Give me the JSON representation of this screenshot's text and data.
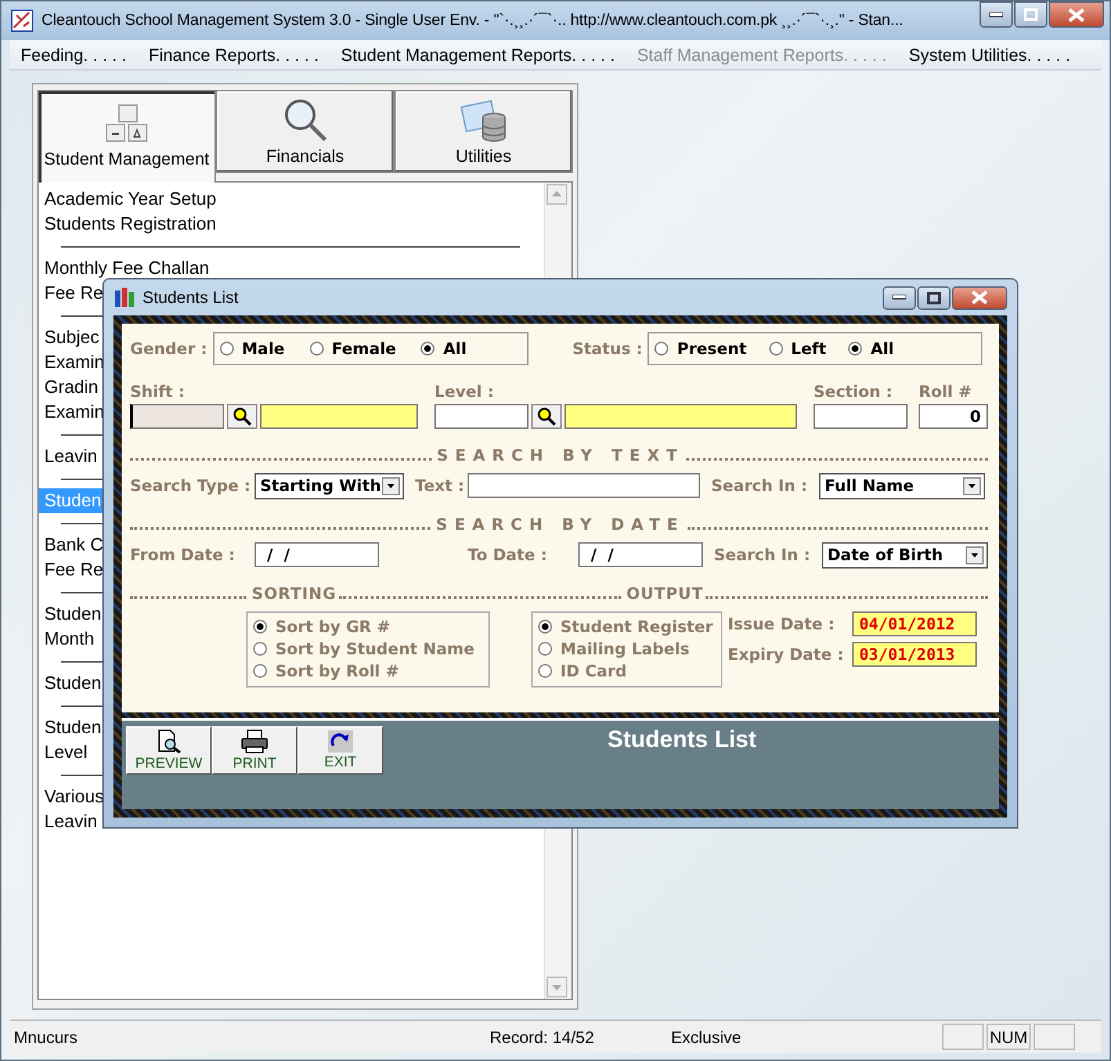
{
  "window": {
    "title": "Cleantouch School Management System 3.0 - Single User Env.     -  \"`·.¸¸.·´¯`·.. http://www.cleantouch.com.pk ¸¸.·´¯`·.¸.\" - Stan..."
  },
  "menu": [
    {
      "label": "Feeding. . . . .",
      "disabled": false
    },
    {
      "label": "Finance Reports. . . . .",
      "disabled": false
    },
    {
      "label": "Student Management Reports. . . . .",
      "disabled": false
    },
    {
      "label": "Staff Management Reports. . . . .",
      "disabled": true
    },
    {
      "label": "System Utilities. . . . .",
      "disabled": false
    }
  ],
  "module_tabs": [
    {
      "label": "Student Management",
      "kind": "keys",
      "selected": true
    },
    {
      "label": "Financials",
      "kind": "magnifier",
      "selected": false
    },
    {
      "label": "Utilities",
      "kind": "database",
      "selected": false
    }
  ],
  "menu_list": [
    [
      {
        "label": "Academic Year Setup",
        "selected": false
      },
      {
        "label": "Students Registration",
        "selected": false
      }
    ],
    [
      {
        "label": "Monthly Fee Challan",
        "selected": false
      },
      {
        "label": "Fee Re",
        "selected": false
      }
    ],
    [
      {
        "label": "Subjec",
        "selected": false
      },
      {
        "label": "Examin",
        "selected": false
      },
      {
        "label": "Gradin",
        "selected": false
      },
      {
        "label": "Examin",
        "selected": false
      }
    ],
    [
      {
        "label": "Leavin",
        "selected": false
      }
    ],
    [
      {
        "label": "Studen",
        "selected": true
      }
    ],
    [
      {
        "label": "Bank C",
        "selected": false
      },
      {
        "label": "Fee Re",
        "selected": false
      }
    ],
    [
      {
        "label": "Studen",
        "selected": false
      },
      {
        "label": "Month",
        "selected": false
      }
    ],
    [
      {
        "label": "Studen",
        "selected": false
      }
    ],
    [
      {
        "label": "Studen",
        "selected": false
      },
      {
        "label": "Level",
        "selected": false
      }
    ],
    [
      {
        "label": "Various",
        "selected": false
      },
      {
        "label": "Leavin",
        "selected": false
      }
    ]
  ],
  "dialog": {
    "title": "Students List",
    "gender": {
      "label": "Gender :",
      "options": [
        {
          "label": "Male",
          "selected": false
        },
        {
          "label": "Female",
          "selected": false
        },
        {
          "label": "All",
          "selected": true
        }
      ]
    },
    "status": {
      "label": "Status :",
      "options": [
        {
          "label": "Present",
          "selected": false
        },
        {
          "label": "Left",
          "selected": false
        },
        {
          "label": "All",
          "selected": true
        }
      ]
    },
    "shift": {
      "label": "Shift :"
    },
    "level": {
      "label": "Level :"
    },
    "section": {
      "label": "Section :"
    },
    "roll": {
      "label": "Roll #",
      "value": "0"
    },
    "search_by_text": {
      "heading": "SEARCH BY TEXT",
      "search_type": {
        "label": "Search Type :",
        "value": "Starting With"
      },
      "text": {
        "label": "Text :"
      },
      "search_in": {
        "label": "Search In :",
        "value": "Full Name"
      }
    },
    "search_by_date": {
      "heading": "SEARCH BY DATE",
      "from_date": {
        "label": "From Date :",
        "value": " /  /"
      },
      "to_date": {
        "label": "To Date :",
        "value": " /  /"
      },
      "search_in": {
        "label": "Search In :",
        "value": "Date of Birth"
      }
    },
    "sorting": {
      "heading": "SORTING",
      "options": [
        {
          "label": "Sort by GR #",
          "selected": true
        },
        {
          "label": "Sort by Student Name",
          "selected": false
        },
        {
          "label": "Sort by Roll #",
          "selected": false
        }
      ]
    },
    "output": {
      "heading": "OUTPUT",
      "options": [
        {
          "label": "Student Register",
          "selected": true
        },
        {
          "label": "Mailing Labels",
          "selected": false
        },
        {
          "label": "ID Card",
          "selected": false
        }
      ]
    },
    "issue_date": {
      "label": "Issue Date :",
      "value": "04/01/2012"
    },
    "expiry_date": {
      "label": "Expiry Date :",
      "value": "03/01/2013"
    },
    "buttons": [
      {
        "label": "PREVIEW",
        "kind": "preview"
      },
      {
        "label": "PRINT",
        "kind": "print"
      },
      {
        "label": "EXIT",
        "kind": "exit"
      }
    ],
    "report_title": "Students List"
  },
  "status_bar": {
    "left": "Mnucurs",
    "record": "Record: 14/52",
    "mode": "Exclusive",
    "indicators": [
      "NUM"
    ]
  }
}
